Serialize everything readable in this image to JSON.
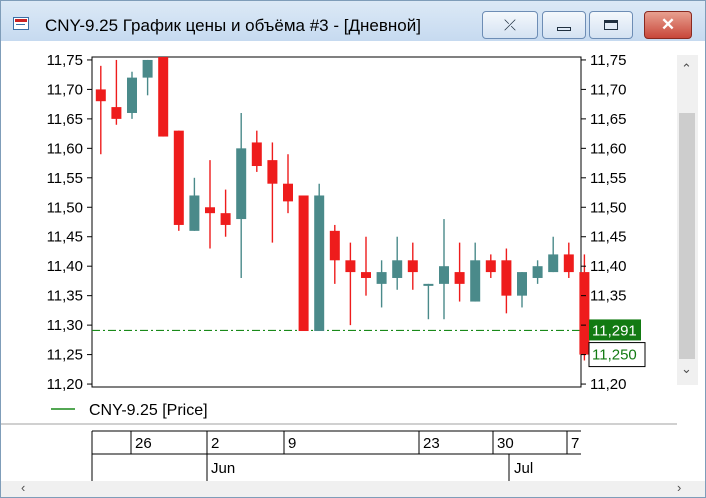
{
  "window": {
    "title": "CNY-9.25 График цены и объёма #3 - [Дневной]",
    "buttons": {
      "pin": "⤫",
      "close": "✕"
    }
  },
  "legend": {
    "label": "CNY-9.25 [Price]"
  },
  "colors": {
    "up": "#4a8a8a",
    "down": "#ee1c1c",
    "reference_line": "#1a8a1a",
    "last_price_bg": "#127a12"
  },
  "time_axis": {
    "days": [
      "26",
      "2",
      "9",
      "23",
      "30",
      "7"
    ],
    "months": [
      "Jun",
      "Jul"
    ]
  },
  "chart_data": {
    "type": "candlestick",
    "title": "",
    "xlabel": "",
    "ylabel": "",
    "ylim": [
      11.195,
      11.755
    ],
    "y_ticks": [
      "11,75",
      "11,70",
      "11,65",
      "11,60",
      "11,55",
      "11,50",
      "11,45",
      "11,40",
      "11,35",
      "11,30",
      "11,25",
      "11,20"
    ],
    "reference_line": {
      "value": 11.291,
      "label": "11,291"
    },
    "last_value": {
      "value": 11.25,
      "label": "11,250"
    },
    "candles": [
      {
        "open": 11.7,
        "high": 11.74,
        "low": 11.59,
        "close": 11.68
      },
      {
        "open": 11.67,
        "high": 11.75,
        "low": 11.64,
        "close": 11.65
      },
      {
        "open": 11.66,
        "high": 11.73,
        "low": 11.65,
        "close": 11.72
      },
      {
        "open": 11.72,
        "high": 11.75,
        "low": 11.69,
        "close": 11.75
      },
      {
        "open": 11.755,
        "high": 11.755,
        "low": 11.62,
        "close": 11.62
      },
      {
        "open": 11.63,
        "high": 11.63,
        "low": 11.46,
        "close": 11.47
      },
      {
        "open": 11.46,
        "high": 11.55,
        "low": 11.46,
        "close": 11.52
      },
      {
        "open": 11.5,
        "high": 11.58,
        "low": 11.43,
        "close": 11.49
      },
      {
        "open": 11.49,
        "high": 11.53,
        "low": 11.45,
        "close": 11.47
      },
      {
        "open": 11.48,
        "high": 11.66,
        "low": 11.38,
        "close": 11.6
      },
      {
        "open": 11.61,
        "high": 11.63,
        "low": 11.56,
        "close": 11.57
      },
      {
        "open": 11.58,
        "high": 11.61,
        "low": 11.44,
        "close": 11.54
      },
      {
        "open": 11.54,
        "high": 11.59,
        "low": 11.49,
        "close": 11.51
      },
      {
        "open": 11.52,
        "high": 11.52,
        "low": 11.29,
        "close": 11.29
      },
      {
        "open": 11.29,
        "high": 11.54,
        "low": 11.29,
        "close": 11.52
      },
      {
        "open": 11.46,
        "high": 11.47,
        "low": 11.37,
        "close": 11.41
      },
      {
        "open": 11.41,
        "high": 11.44,
        "low": 11.3,
        "close": 11.39
      },
      {
        "open": 11.39,
        "high": 11.45,
        "low": 11.35,
        "close": 11.38
      },
      {
        "open": 11.37,
        "high": 11.41,
        "low": 11.33,
        "close": 11.39
      },
      {
        "open": 11.38,
        "high": 11.45,
        "low": 11.36,
        "close": 11.41
      },
      {
        "open": 11.41,
        "high": 11.44,
        "low": 11.36,
        "close": 11.39
      },
      {
        "open": 11.37,
        "high": 11.37,
        "low": 11.31,
        "close": 11.37
      },
      {
        "open": 11.37,
        "high": 11.48,
        "low": 11.31,
        "close": 11.4
      },
      {
        "open": 11.39,
        "high": 11.44,
        "low": 11.34,
        "close": 11.37
      },
      {
        "open": 11.34,
        "high": 11.44,
        "low": 11.34,
        "close": 11.41
      },
      {
        "open": 11.41,
        "high": 11.42,
        "low": 11.38,
        "close": 11.39
      },
      {
        "open": 11.41,
        "high": 11.43,
        "low": 11.32,
        "close": 11.35
      },
      {
        "open": 11.35,
        "high": 11.39,
        "low": 11.33,
        "close": 11.39
      },
      {
        "open": 11.38,
        "high": 11.41,
        "low": 11.37,
        "close": 11.4
      },
      {
        "open": 11.39,
        "high": 11.45,
        "low": 11.39,
        "close": 11.42
      },
      {
        "open": 11.42,
        "high": 11.44,
        "low": 11.38,
        "close": 11.39
      },
      {
        "open": 11.39,
        "high": 11.42,
        "low": 11.24,
        "close": 11.25
      }
    ]
  }
}
